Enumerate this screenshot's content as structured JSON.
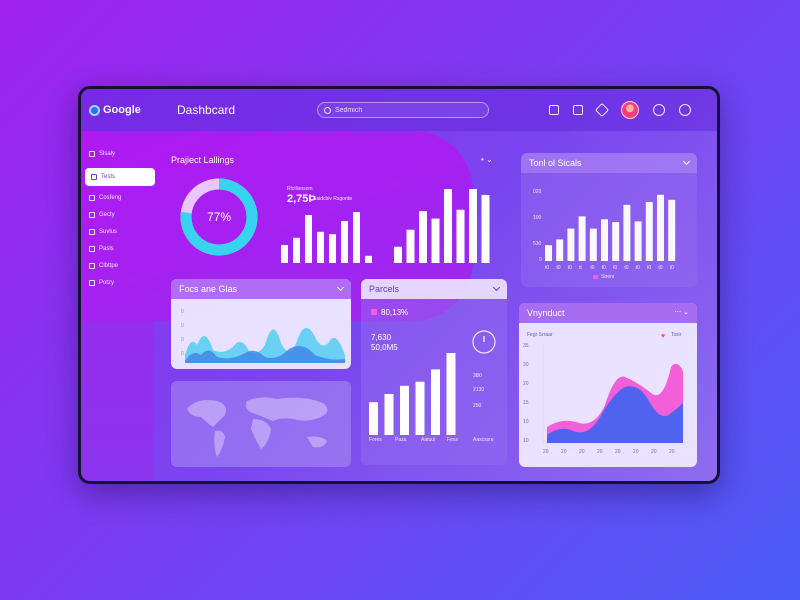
{
  "topbar": {
    "logo_text": "Google",
    "title": "Dashbcard",
    "search_placeholder": "Sedmich"
  },
  "sidebar": {
    "items": [
      {
        "label": "Slsaly"
      },
      {
        "label": "Tests"
      },
      {
        "label": "Cosfeng"
      },
      {
        "label": "Gecty"
      },
      {
        "label": "Suvlus"
      },
      {
        "label": "Pasls"
      },
      {
        "label": "Clbttpe"
      },
      {
        "label": "Potzy"
      }
    ],
    "active_index": 1
  },
  "project_listings": {
    "title": "Prajiect Lallings",
    "donut_percent": 77,
    "donut_label": "77%",
    "stat_label": "Rlctlisnsom",
    "stat_value": "2,75Þ",
    "stat_sub": "Saidcbiv Rsgorde",
    "bars_a": [
      0.3,
      0.42,
      0.8,
      0.52,
      0.48,
      0.7,
      0.85,
      0.12
    ],
    "bars_b": [
      0.22,
      0.45,
      0.7,
      0.6,
      1.0,
      0.72,
      1.0,
      0.92
    ]
  },
  "total_sales": {
    "title": "Tonl ol Sicals",
    "y_ticks": [
      "020",
      "100",
      "530",
      "0"
    ],
    "x_ticks": [
      "t0",
      "t0",
      "t0",
      "tt",
      "t0",
      "t0",
      "t0",
      "t0",
      "t0",
      "t0",
      "t0",
      "t0"
    ],
    "legend": "Strenr",
    "bars": [
      0.22,
      0.3,
      0.45,
      0.62,
      0.45,
      0.58,
      0.54,
      0.78,
      0.55,
      0.82,
      0.92,
      0.85
    ]
  },
  "focus": {
    "title": "Focs ane Glas",
    "y_ticks": [
      "0",
      "0",
      "0",
      "0"
    ]
  },
  "parcels": {
    "title": "Parcels",
    "stat1": "80,13%",
    "stat2": "7,630",
    "stat3": "50,0M5",
    "bars": [
      0.4,
      0.5,
      0.6,
      0.65,
      0.8,
      1.0
    ],
    "x_labels": [
      "Fores",
      "Paza",
      "Aatuul",
      "Fess",
      "Aascssre"
    ],
    "y_ticks": [
      "3B0",
      "2130",
      "250"
    ]
  },
  "vynduct": {
    "title": "Vnynduct",
    "legend_left": "Fegr Srraar",
    "legend_right": "Tsslr",
    "y_ticks": [
      "35",
      "30",
      "20",
      "15",
      "10",
      "10"
    ],
    "x_ticks": [
      "20",
      "20",
      "20",
      "20",
      "20",
      "20",
      "20",
      "20"
    ],
    "colors": {
      "pink": "#f25fd8",
      "blue": "#4f63ee"
    }
  },
  "map": {
    "title": ""
  },
  "colors": {
    "accent": "#8f35ef",
    "bar": "#ffffff"
  }
}
